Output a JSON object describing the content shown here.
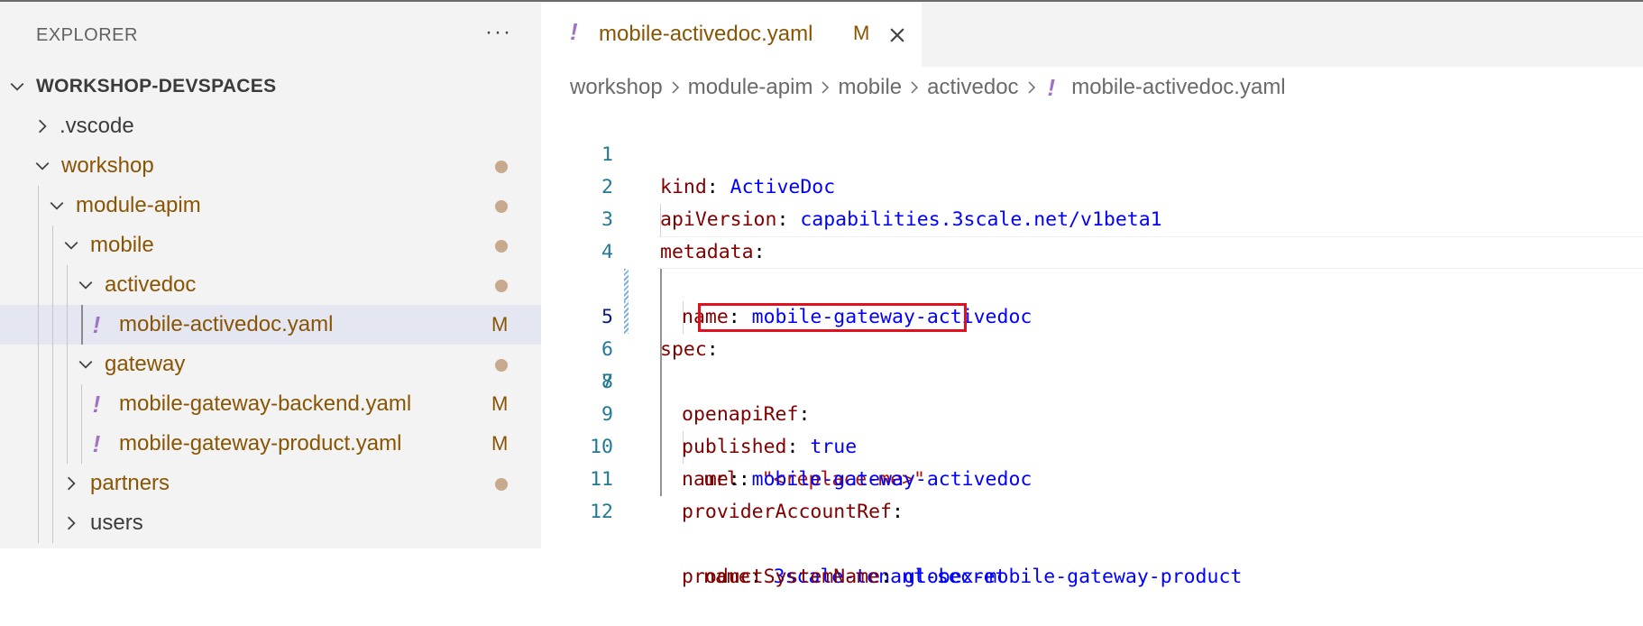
{
  "explorer": {
    "title": "EXPLORER",
    "more_label": "···",
    "root": "WORKSHOP-DEVSPACES",
    "items": [
      {
        "label": ".vscode",
        "expanded": false,
        "modified": false
      },
      {
        "label": "workshop",
        "expanded": true,
        "modified": true
      },
      {
        "label": "module-apim",
        "expanded": true,
        "modified": true
      },
      {
        "label": "mobile",
        "expanded": true,
        "modified": true
      },
      {
        "label": "activedoc",
        "expanded": true,
        "modified": true
      },
      {
        "label": "mobile-activedoc.yaml",
        "badge": "M",
        "selected": true
      },
      {
        "label": "gateway",
        "expanded": true,
        "modified": true
      },
      {
        "label": "mobile-gateway-backend.yaml",
        "badge": "M"
      },
      {
        "label": "mobile-gateway-product.yaml",
        "badge": "M"
      },
      {
        "label": "partners",
        "expanded": false,
        "modified": true
      },
      {
        "label": "users",
        "expanded": false,
        "modified": false
      }
    ],
    "yaml_icon_glyph": "!"
  },
  "editor": {
    "tab": {
      "label": "mobile-activedoc.yaml",
      "badge": "M",
      "icon": "yaml-icon"
    },
    "breadcrumb": [
      "workshop",
      "module-apim",
      "mobile",
      "activedoc",
      "mobile-activedoc.yaml"
    ],
    "lines": [
      {
        "n": "1",
        "key": "kind",
        "val": "ActiveDoc"
      },
      {
        "n": "2",
        "key": "apiVersion",
        "val": "capabilities.3scale.net/v1beta1"
      },
      {
        "n": "3",
        "key": "metadata",
        "val": ""
      },
      {
        "n": "4",
        "key": "name",
        "val": "mobile-gateway-activedoc"
      },
      {
        "n": "5",
        "key": "spec",
        "val": ""
      },
      {
        "n": "6",
        "key": "openapiRef",
        "val": ""
      },
      {
        "n": "7",
        "key": "url",
        "str": "\"<replace-me>\""
      },
      {
        "n": "8",
        "key": "published",
        "val": "true"
      },
      {
        "n": "9",
        "key": "name",
        "val": "mobile-gateway-activedoc"
      },
      {
        "n": "10",
        "key": "providerAccountRef",
        "val": ""
      },
      {
        "n": "11",
        "key": "name",
        "val": "3scale-tenant-secret"
      },
      {
        "n": "12",
        "key": "productSystemName",
        "val": "globex-mobile-gateway-product"
      }
    ]
  },
  "colors": {
    "modified_folder": "#895503",
    "modified_dot": "#c8a98d",
    "yaml_icon": "#a074c4",
    "yaml_key": "#800000",
    "yaml_value": "#0000ff",
    "yaml_string": "#a31515",
    "highlight_box": "#e0101d"
  }
}
